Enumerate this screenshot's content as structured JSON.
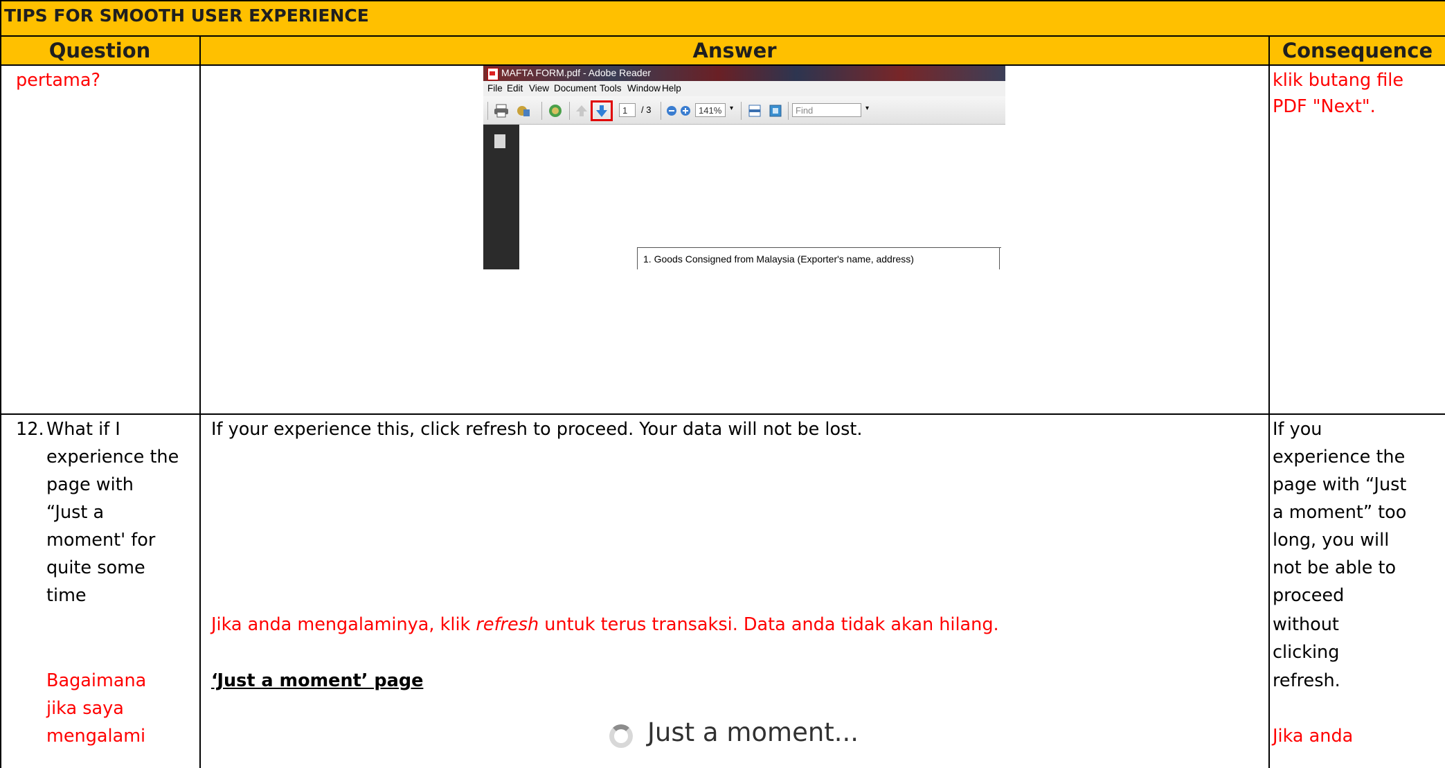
{
  "banner": {
    "title": "TIPS FOR SMOOTH USER EXPERIENCE"
  },
  "header": {
    "question": "Question",
    "answer": "Answer",
    "consequence": "Consequence"
  },
  "row_prev": {
    "question_line": "pertama?",
    "consequence_lines": [
      "klik butang file",
      "PDF \"Next\"."
    ]
  },
  "reader_shot": {
    "window_title": "MAFTA FORM.pdf - Adobe Reader",
    "menu": [
      "File",
      "Edit",
      "View",
      "Document",
      "Tools",
      "Window",
      "Help"
    ],
    "page_current": "1",
    "page_total": "/ 3",
    "zoom": "141%",
    "find_placeholder": "Find",
    "form_field": "1. Goods Consigned from Malaysia (Exporter's name, address)",
    "highlight_color": "#e00000",
    "next_arrow_color": "#2f7fd6"
  },
  "row12": {
    "number": "12.",
    "question_lines": [
      "What if I",
      "experience the",
      "page with",
      "“Just a",
      "moment' for",
      "quite some",
      "time"
    ],
    "question_ms_lines": [
      "Bagaimana",
      "jika saya",
      "mengalami"
    ],
    "answer_en": "If your experience this, click refresh to proceed. Your data will not be lost.",
    "answer_ms_pre": "Jika anda mengalaminya, klik ",
    "answer_ms_ital": "refresh",
    "answer_ms_post": " untuk terus transaksi. Data anda tidak akan hilang.",
    "page_heading": "‘Just a moment’ page",
    "just_a_moment": "Just a moment...",
    "consequence_lines": [
      "If you",
      "experience the",
      "page with “Just",
      "a moment” too",
      "long, you will",
      "not be able to",
      "proceed",
      "without",
      "clicking",
      "refresh."
    ],
    "consequence_ms_line": "Jika anda"
  },
  "colors": {
    "header_bg": "#ffc000",
    "malay_text": "#ff0000"
  }
}
